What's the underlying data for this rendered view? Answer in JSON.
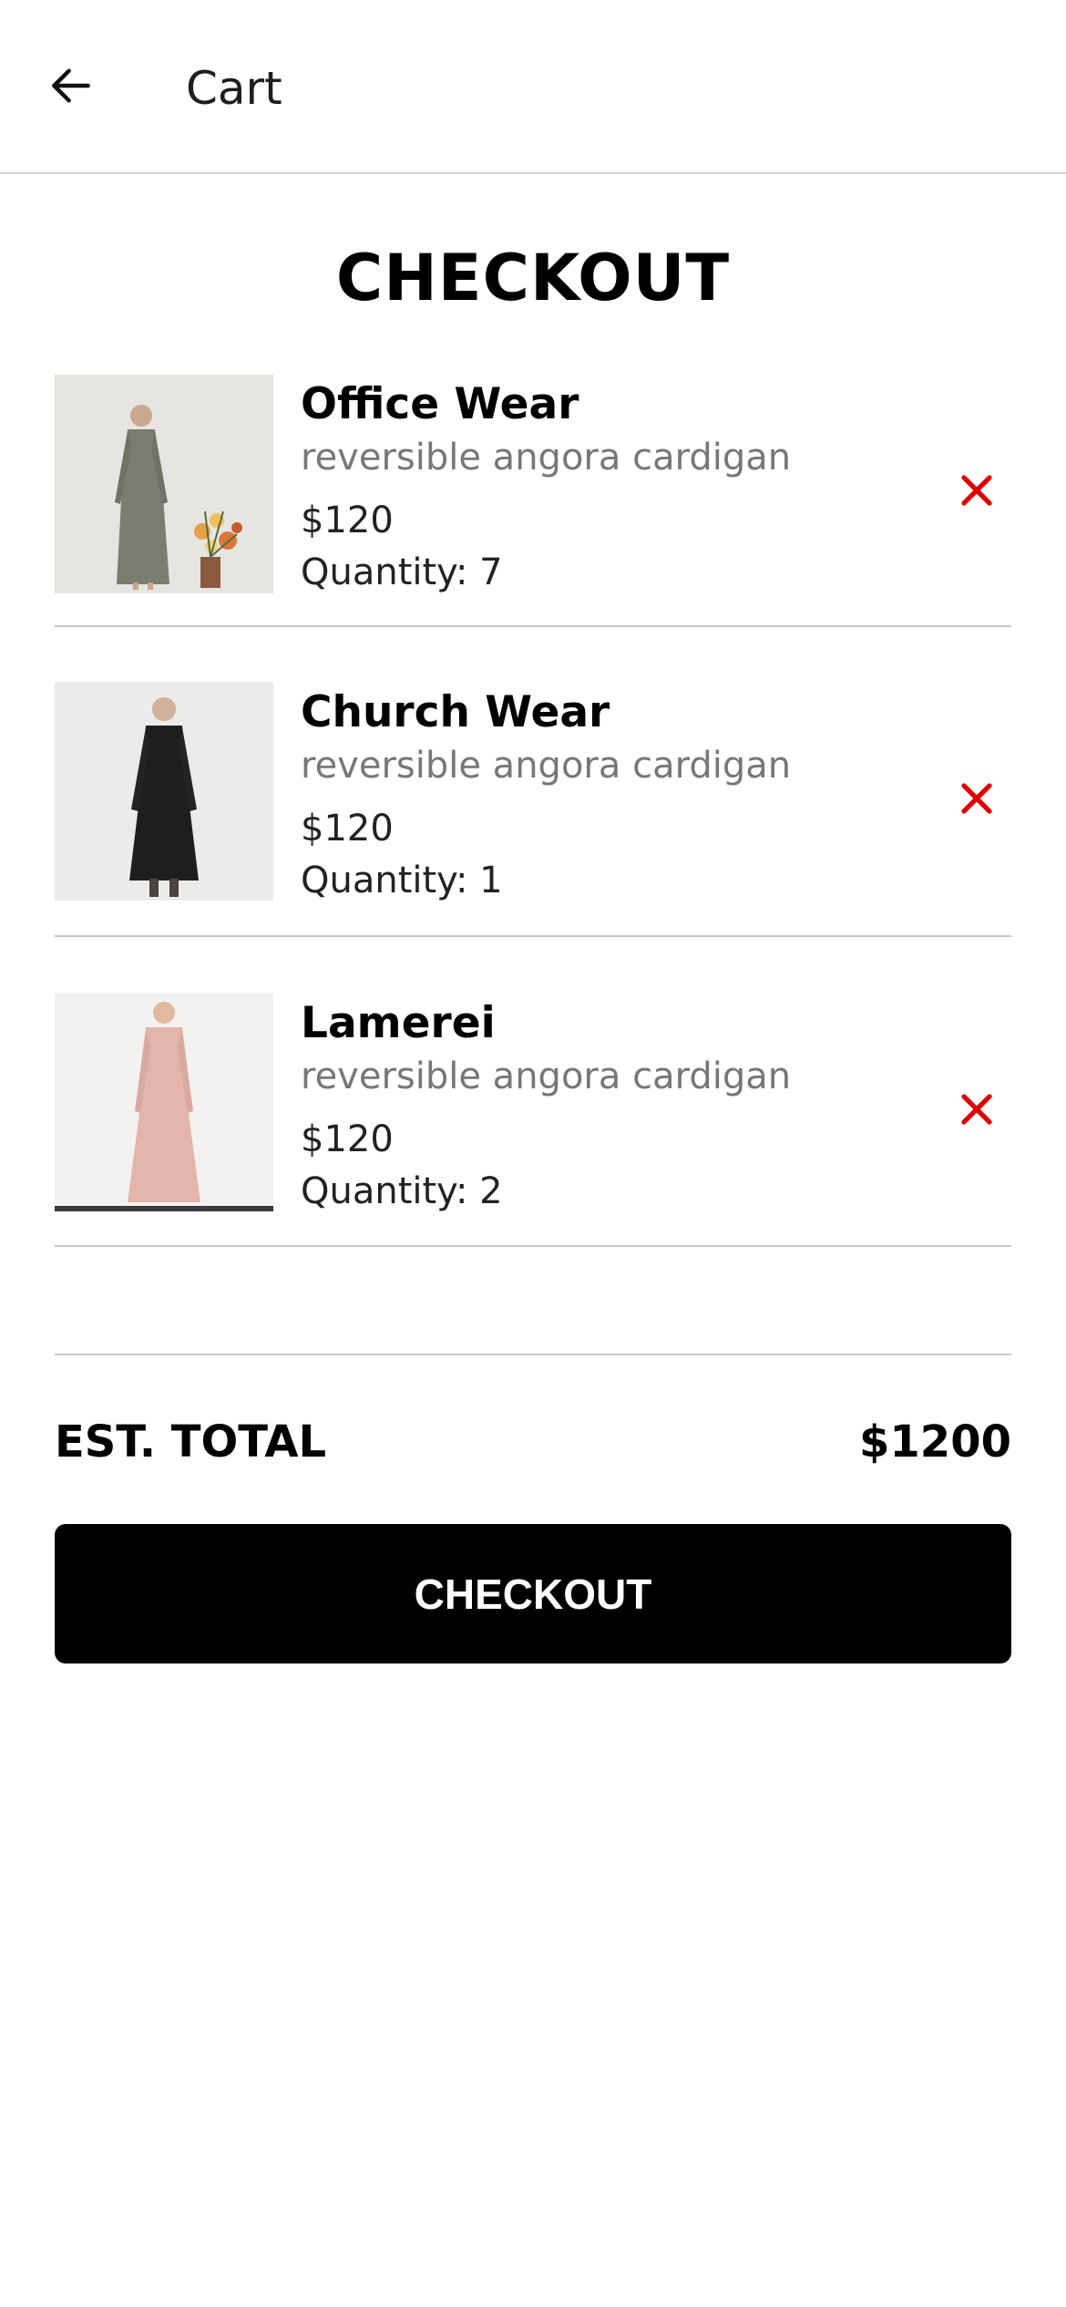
{
  "header": {
    "back_icon": "arrow-left-icon",
    "title": "Cart"
  },
  "page_heading": "CHECKOUT",
  "cart": {
    "items": [
      {
        "name": "Office Wear",
        "description": "reversible angora cardigan",
        "price": "$120",
        "quantity": "Quantity: 7",
        "remove_icon": "close-icon",
        "remove_color": "#e00000",
        "dress_color": "#7a7d6f"
      },
      {
        "name": "Church Wear",
        "description": "reversible angora cardigan",
        "price": "$120",
        "quantity": "Quantity: 1",
        "remove_icon": "close-icon",
        "remove_color": "#e00000",
        "dress_color": "#1e1e1e"
      },
      {
        "name": "Lamerei",
        "description": "reversible angora cardigan",
        "price": "$120",
        "quantity": "Quantity: 2",
        "remove_icon": "close-icon",
        "remove_color": "#e00000",
        "dress_color": "#e2b6ad"
      }
    ]
  },
  "summary": {
    "total_label": "EST. TOTAL",
    "total_value": "$1200"
  },
  "checkout_button": {
    "label": "CHECKOUT"
  }
}
